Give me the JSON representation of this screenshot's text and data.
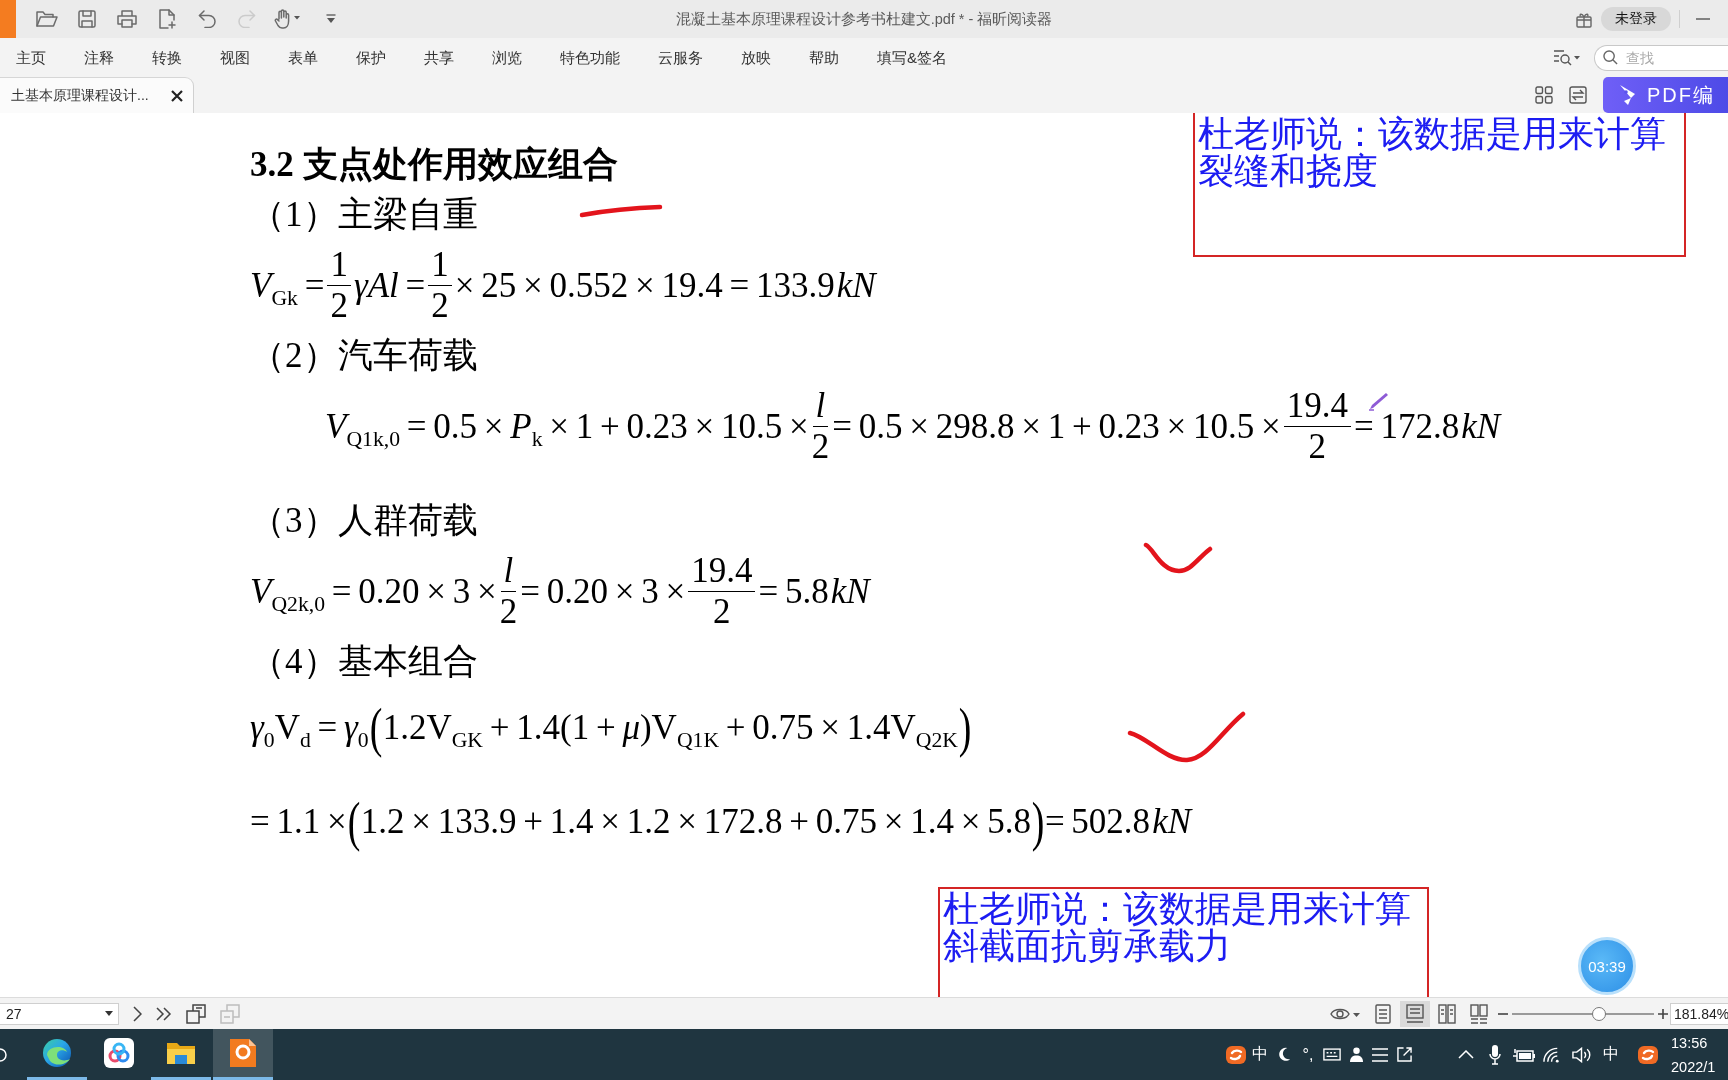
{
  "title_bar": {
    "quick_access": [
      {
        "disabled": false
      },
      {
        "disabled": false
      },
      {
        "disabled": false
      },
      {
        "disabled": false
      },
      {
        "disabled": false
      },
      {
        "disabled": true
      },
      {
        "disabled": false
      },
      {
        "disabled": false
      }
    ],
    "title": "混凝土基本原理课程设计参考书杜建文.pdf * - 福昕阅读器",
    "login_button": "未登录"
  },
  "menu_bar": {
    "items": [
      "主页",
      "注释",
      "转换",
      "视图",
      "表单",
      "保护",
      "共享",
      "浏览",
      "特色功能",
      "云服务",
      "放映",
      "帮助",
      "填写&签名"
    ],
    "search": {
      "placeholder": "查找"
    }
  },
  "tabs": [
    {
      "label": "土基本原理课程设计...",
      "selected": true
    }
  ],
  "pdf_edit_button": "PDF编",
  "document": {
    "blocks": [
      {
        "kind": "heading",
        "text": "3.2 支点处作用效应组合"
      },
      {
        "kind": "subheading",
        "text": "（1）主梁自重"
      },
      {
        "kind": "formula",
        "parts": [
          {
            "kind": "text",
            "text": "*V*$_{Gk}$ ="
          },
          {
            "kind": "fraction",
            "numerator": "1",
            "denominator": "2"
          },
          {
            "kind": "text",
            "text": "*γAl* ="
          },
          {
            "kind": "fraction",
            "numerator": "1",
            "denominator": "2"
          },
          {
            "kind": "text",
            "text": "× 25 × 0.552 × 19.4 = 133.9"
          },
          {
            "kind": "unit",
            "text": "kN"
          }
        ]
      },
      {
        "kind": "subheading",
        "text": "（2）汽车荷载"
      },
      {
        "kind": "display_formula",
        "parts": [
          {
            "kind": "text",
            "text": "*V*$_{Q1k,0}$ = 0.5 × *P*$_{k}$ × 1 + 0.23 × 10.5 ×"
          },
          {
            "kind": "fraction",
            "numerator": "*l*",
            "denominator": "2"
          },
          {
            "kind": "text",
            "text": "= 0.5 × 298.8 × 1 + 0.23 × 10.5 ×"
          },
          {
            "kind": "fraction",
            "numerator": "19.4",
            "denominator": "2"
          },
          {
            "kind": "text",
            "text": "= 172.8"
          },
          {
            "kind": "unit",
            "text": "kN"
          }
        ]
      },
      {
        "kind": "subheading",
        "text": "（3）人群荷载"
      },
      {
        "kind": "formula",
        "parts": [
          {
            "kind": "text",
            "text": "*V*$_{Q2k,0}$ = 0.20 × 3 ×"
          },
          {
            "kind": "fraction",
            "numerator": "*l*",
            "denominator": "2"
          },
          {
            "kind": "text",
            "text": "= 0.20 × 3 ×"
          },
          {
            "kind": "fraction",
            "numerator": "19.4",
            "denominator": "2"
          },
          {
            "kind": "text",
            "text": "= 5.8"
          },
          {
            "kind": "unit",
            "text": "kN"
          }
        ]
      },
      {
        "kind": "subheading",
        "text": "（4）基本组合"
      },
      {
        "kind": "formula",
        "parts": [
          {
            "kind": "text",
            "text": "*γ*$_{0}$V$_{d}$ = *γ*$_{0}$"
          },
          {
            "kind": "paren",
            "text": "("
          },
          {
            "kind": "text",
            "text": "1.2V$_{GK}$ + 1.4(1 + *μ*)V$_{Q1K}$ + 0.75 × 1.4V$_{Q2K}$"
          },
          {
            "kind": "paren",
            "text": ")"
          }
        ]
      },
      {
        "kind": "formula",
        "parts": [
          {
            "kind": "text",
            "text": "= 1.1 ×"
          },
          {
            "kind": "paren",
            "text": "("
          },
          {
            "kind": "text",
            "text": "1.2 × 133.9 + 1.4 × 1.2 × 172.8 + 0.75 × 1.4 × 5.8"
          },
          {
            "kind": "paren",
            "text": ")"
          },
          {
            "kind": "text",
            "text": "= 502.8"
          },
          {
            "kind": "unit",
            "text": "kN"
          }
        ]
      }
    ],
    "comments": [
      {
        "text": "杜老师说：该数据是用来计算裂缝和挠度"
      },
      {
        "text": "杜老师说：该数据是用来计算斜截面抗剪承载力"
      }
    ]
  },
  "timer_bubble": "03:39",
  "status_bar": {
    "page_field": "27",
    "nav_buttons": [
      {
        "disabled": false
      },
      {
        "disabled": false
      },
      {
        "disabled": false
      },
      {
        "disabled": true
      }
    ],
    "view_modes": [
      {
        "selected": false
      },
      {
        "selected": true
      },
      {
        "selected": false
      },
      {
        "selected": false
      }
    ],
    "zoom_slider": {
      "level": 0.61
    },
    "zoom_value": "181.84%"
  },
  "taskbar": {
    "apps": [
      {
        "running": true,
        "active": false
      },
      {
        "running": false,
        "active": false
      },
      {
        "running": true,
        "active": false
      },
      {
        "running": true,
        "active": true
      }
    ],
    "tray": {
      "ime_mode": "中",
      "punctuation_mode": "°,",
      "language": "中",
      "time": "13:56",
      "date": "2022/1"
    }
  }
}
